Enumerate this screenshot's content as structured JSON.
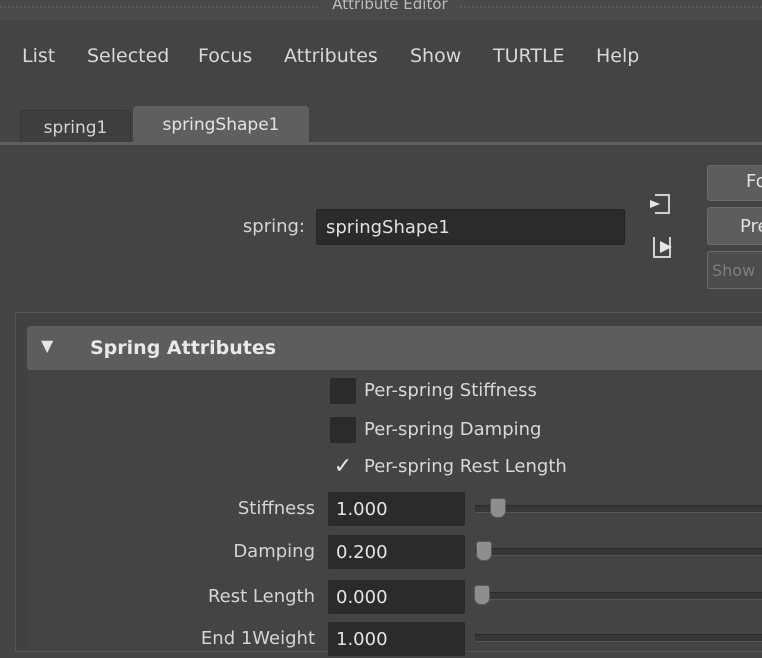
{
  "window": {
    "title": "Attribute Editor"
  },
  "menu": [
    "List",
    "Selected",
    "Focus",
    "Attributes",
    "Show",
    "TURTLE",
    "Help"
  ],
  "tabs": [
    {
      "label": "spring1",
      "active": false
    },
    {
      "label": "springShape1",
      "active": true
    }
  ],
  "node": {
    "label": "spring:",
    "value": "springShape1"
  },
  "side_buttons": {
    "focus": "Fo",
    "presets": "Pre",
    "show": "Show"
  },
  "icons": {
    "load": "select-node-icon",
    "copy": "copy-tab-icon"
  },
  "section": {
    "title": "Spring Attributes",
    "expanded": true,
    "arrow": "▼"
  },
  "checkboxes": [
    {
      "label": "Per-spring Stiffness",
      "checked": false
    },
    {
      "label": "Per-spring Damping",
      "checked": false
    },
    {
      "label": "Per-spring Rest Length",
      "checked": true,
      "mark": "✓"
    }
  ],
  "fields": [
    {
      "label": "Stiffness",
      "value": "1.000"
    },
    {
      "label": "Damping",
      "value": "0.200"
    },
    {
      "label": "Rest Length",
      "value": "0.000"
    },
    {
      "label": "End 1Weight",
      "value": "1.000"
    }
  ],
  "colors": {
    "background": "#444444",
    "field": "#2b2b2b",
    "header": "#5d5d5d"
  }
}
